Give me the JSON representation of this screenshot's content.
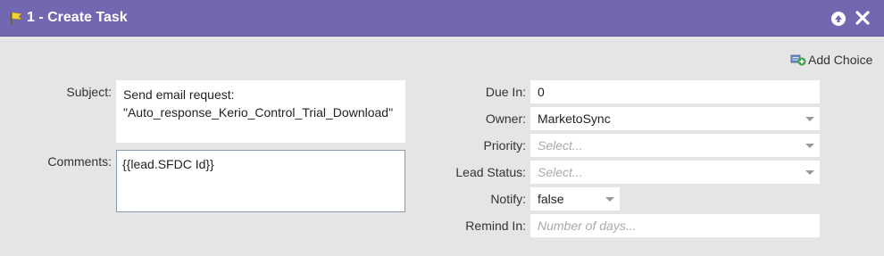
{
  "header": {
    "title": "1 - Create Task",
    "icons": [
      "flag-icon",
      "arrow-up-icon",
      "close-icon"
    ]
  },
  "toolbar": {
    "add_choice_label": "Add Choice"
  },
  "left": {
    "subject_label": "Subject:",
    "subject_line1": "Send email request:",
    "subject_line2": "\"Auto_response_Kerio_Control_Trial_Download\"",
    "comments_label": "Comments:",
    "comments_value": "{{lead.SFDC Id}}"
  },
  "right": {
    "due_in_label": "Due In:",
    "due_in_value": "0",
    "owner_label": "Owner:",
    "owner_value": "MarketoSync",
    "priority_label": "Priority:",
    "priority_placeholder": "Select...",
    "lead_status_label": "Lead Status:",
    "lead_status_placeholder": "Select...",
    "notify_label": "Notify:",
    "notify_value": "false",
    "remind_in_label": "Remind In:",
    "remind_in_placeholder": "Number of days..."
  },
  "colors": {
    "header_bg": "#7268b2",
    "panel_bg": "#e5e5e5",
    "comments_border": "#8b99ad"
  }
}
